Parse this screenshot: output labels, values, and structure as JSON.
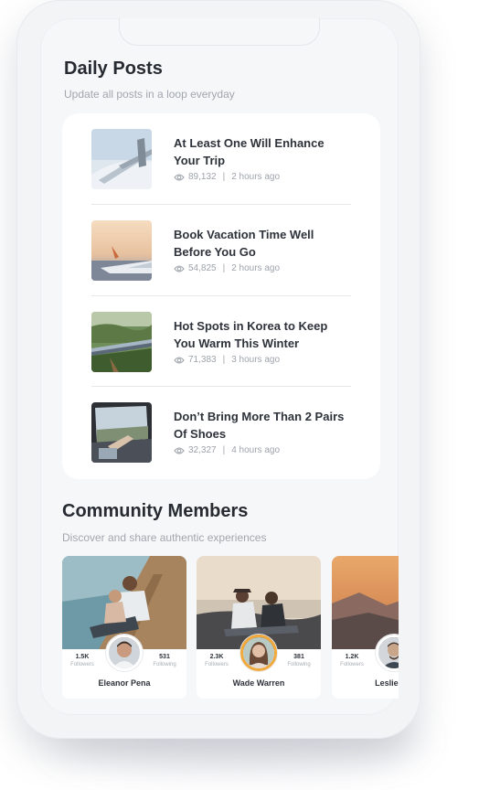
{
  "daily_posts": {
    "title": "Daily Posts",
    "subtitle": "Update all posts in a loop everyday",
    "items": [
      {
        "title": "At Least One Will Enhance Your Trip",
        "views": "89,132",
        "separator": "|",
        "time": "2 hours ago",
        "thumb": "airport-terminal"
      },
      {
        "title": "Book Vacation Time Well Before You Go",
        "views": "54,825",
        "separator": "|",
        "time": "2 hours ago",
        "thumb": "airplane-wing"
      },
      {
        "title": "Hot Spots in Korea to Keep You Warm This Winter",
        "views": "71,383",
        "separator": "|",
        "time": "3 hours ago",
        "thumb": "mountain-train"
      },
      {
        "title": "Don’t Bring More Than 2 Pairs Of Shoes",
        "views": "32,327",
        "separator": "|",
        "time": "4 hours ago",
        "thumb": "car-window-feet"
      }
    ]
  },
  "community": {
    "title": "Community Members",
    "subtitle": "Discover and share authentic experiences",
    "members": [
      {
        "name": "Eleanor Pena",
        "followers": "1.5K",
        "followers_label": "Followers",
        "following": "531",
        "following_label": "Following"
      },
      {
        "name": "Wade Warren",
        "followers": "2.3K",
        "followers_label": "Followers",
        "following": "381",
        "following_label": "Following"
      },
      {
        "name": "Leslie Ale",
        "followers": "1.2K",
        "followers_label": "Followers",
        "following": "",
        "following_label": ""
      }
    ]
  },
  "colors": {
    "background": "#f6f7f9",
    "card": "#ffffff",
    "heading": "#262a31",
    "muted": "#a1a6ae",
    "avatar_ring": "#f2a93b"
  },
  "icons": {
    "views": "eye-icon"
  }
}
